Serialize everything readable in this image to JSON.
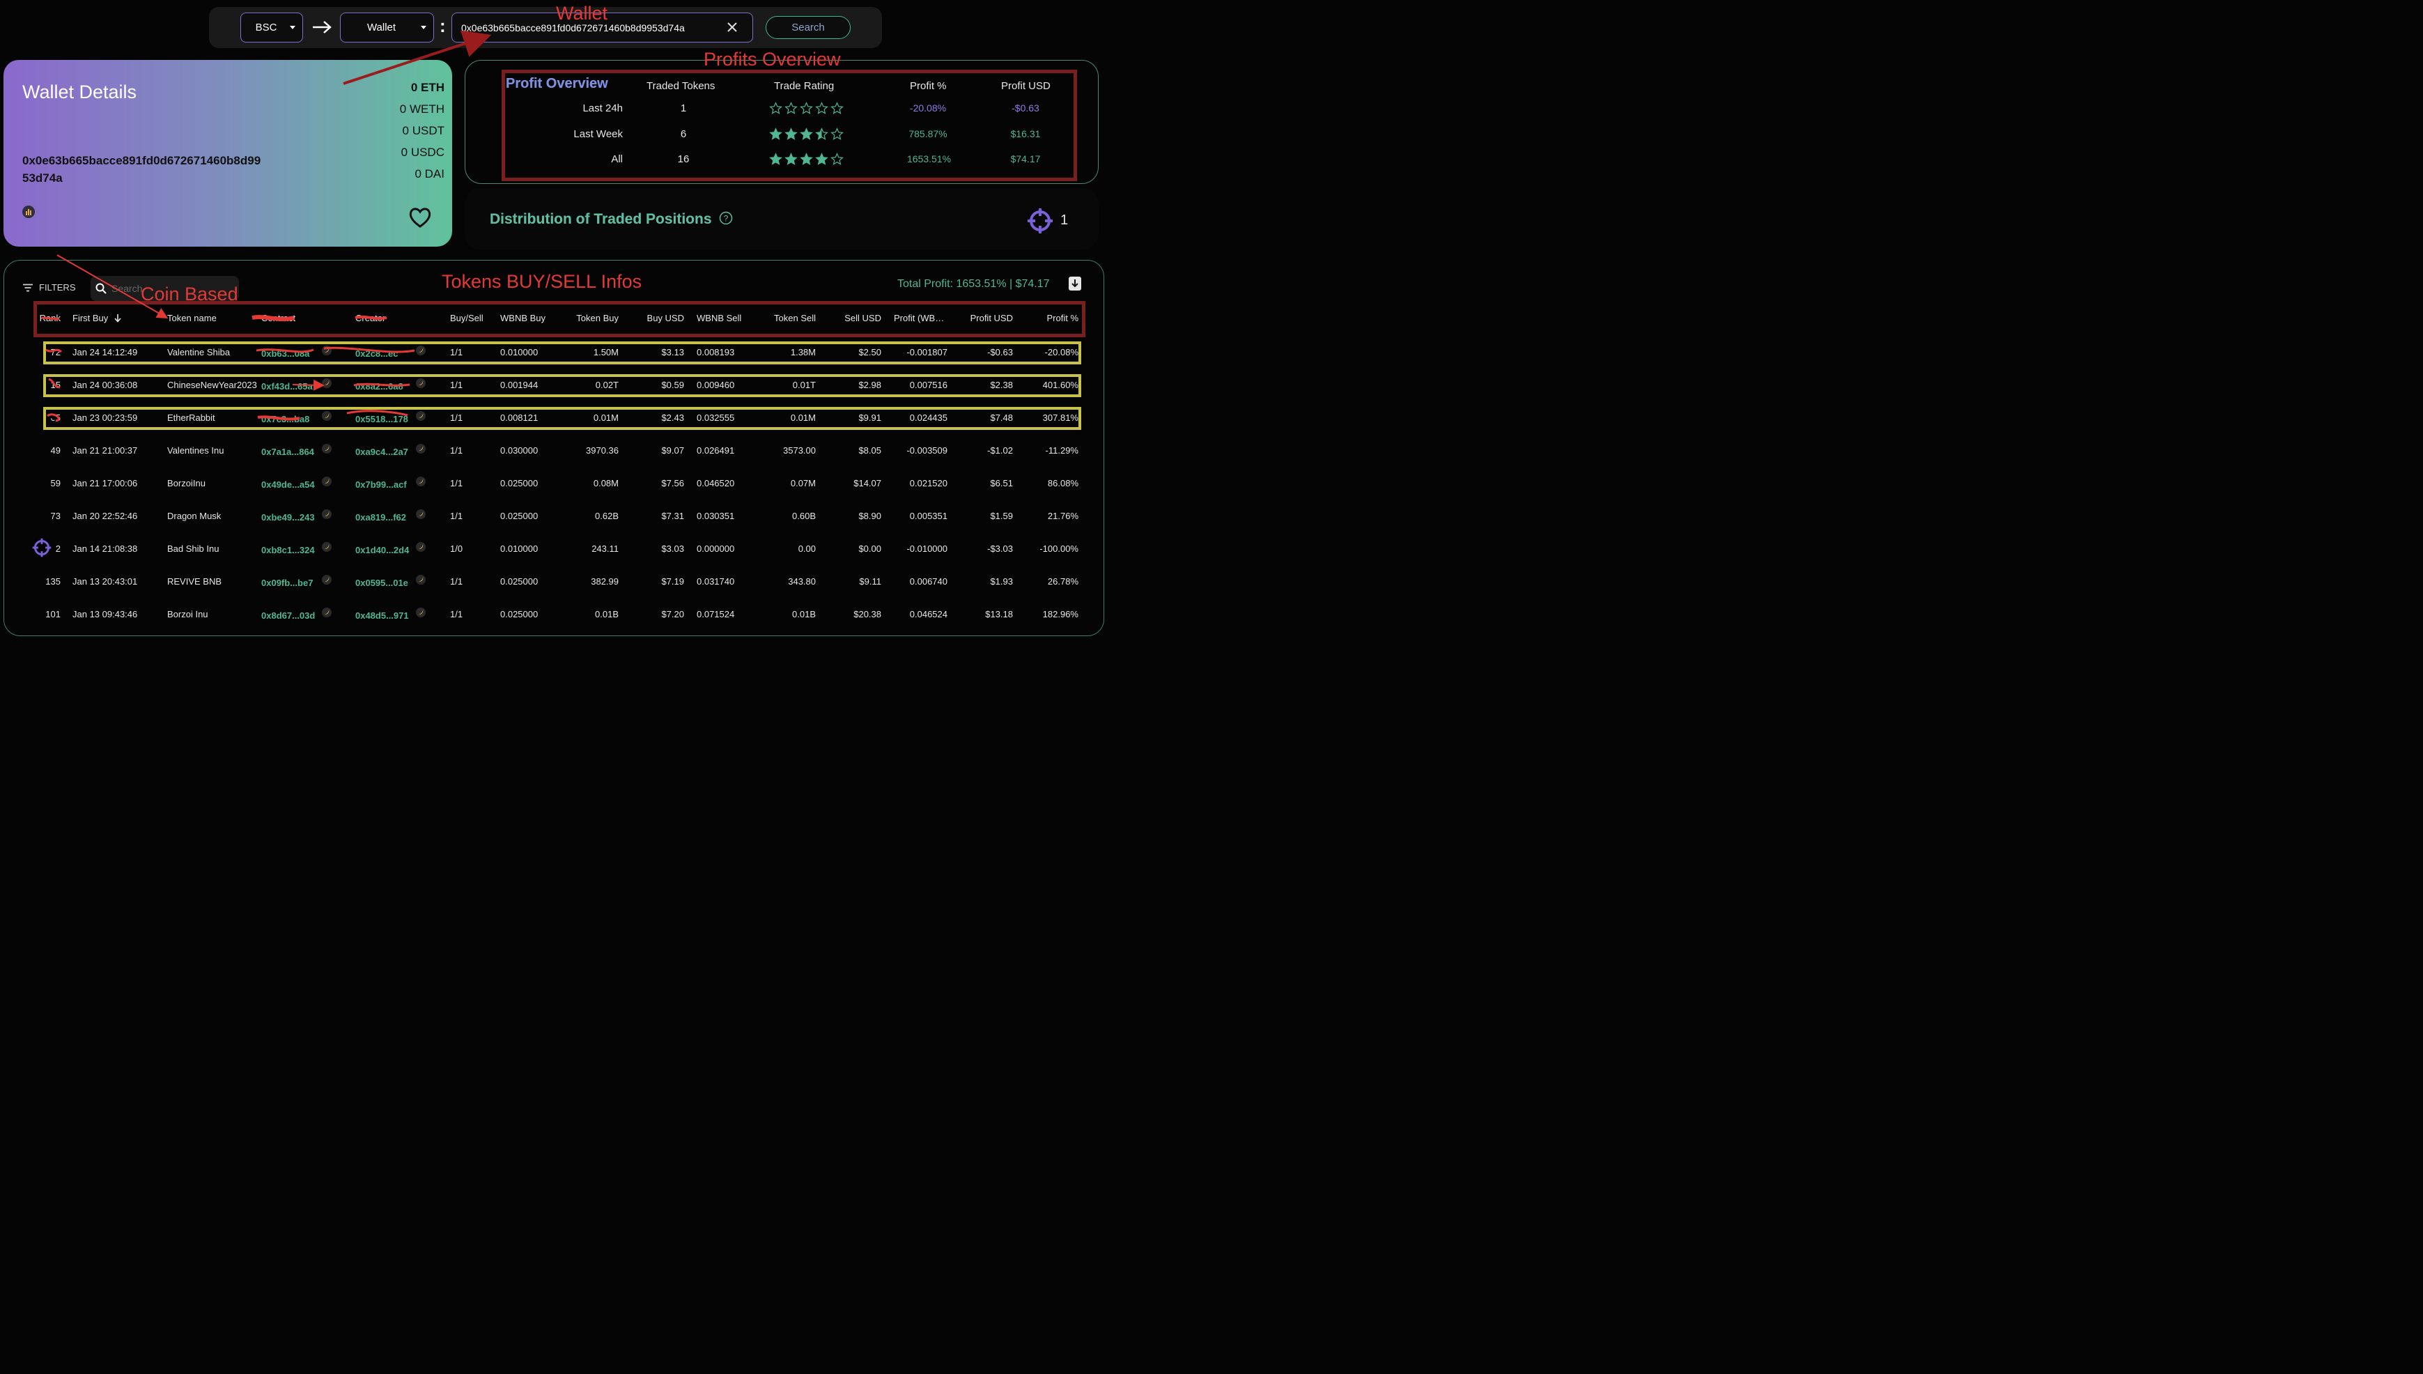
{
  "search_bar": {
    "chain": "BSC",
    "type": "Wallet",
    "address_value": "0x0e63b665bacce891fd0d672671460b8d9953d74a",
    "search_label": "Search"
  },
  "annotations": {
    "wallet": "Wallet",
    "profits_overview": "Profits Overview",
    "coin_based": "Coin Based",
    "tokens_info": "Tokens BUY/SELL Infos"
  },
  "wallet_card": {
    "title": "Wallet Details",
    "address_line1": "0x0e63b665bacce891fd0d672671460b8d99",
    "address_line2": "53d74a",
    "balances": [
      "0 ETH",
      "0 WETH",
      "0 USDT",
      "0 USDC",
      "0 DAI"
    ]
  },
  "profit_overview": {
    "title": "Profit Overview",
    "headers": [
      "Traded Tokens",
      "Trade Rating",
      "Profit %",
      "Profit USD"
    ],
    "rows": [
      {
        "label": "Last 24h",
        "traded": "1",
        "rating": 0,
        "pct": "-20.08%",
        "usd": "-$0.63",
        "negative": true
      },
      {
        "label": "Last Week",
        "traded": "6",
        "rating": 3.5,
        "pct": "785.87%",
        "usd": "$16.31",
        "negative": false
      },
      {
        "label": "All",
        "traded": "16",
        "rating": 4,
        "pct": "1653.51%",
        "usd": "$74.17",
        "negative": false
      }
    ]
  },
  "distribution": {
    "title": "Distribution of Traded Positions",
    "count": "1"
  },
  "table": {
    "filters_label": "FILTERS",
    "search_placeholder": "Search",
    "total_profit": "Total Profit: 1653.51% | $74.17",
    "headers": [
      "Rank",
      "First Buy",
      "Token name",
      "Contract",
      "Creator",
      "Buy/Sell",
      "WBNB Buy",
      "Token Buy",
      "Buy USD",
      "WBNB Sell",
      "Token Sell",
      "Sell USD",
      "Profit (WB…",
      "Profit USD",
      "Profit %"
    ],
    "rows": [
      {
        "rank": "72",
        "first_buy": "Jan 24 14:12:49",
        "token": "Valentine Shiba",
        "contract": "0xb63...08a",
        "creator": "0x2c8...ec",
        "bs": "1/1",
        "wbnb_buy": "0.010000",
        "token_buy": "1.50M",
        "buy_usd": "$3.13",
        "wbnb_sell": "0.008193",
        "token_sell": "1.38M",
        "sell_usd": "$2.50",
        "profit_wbnb": "-0.001807",
        "profit_usd": "-$0.63",
        "profit_pct": "-20.08%"
      },
      {
        "rank": "15",
        "first_buy": "Jan 24 00:36:08",
        "token": "ChineseNewYear2023",
        "contract": "0xf43d...65a",
        "creator": "0x8a2...6a8",
        "bs": "1/1",
        "wbnb_buy": "0.001944",
        "token_buy": "0.02T",
        "buy_usd": "$0.59",
        "wbnb_sell": "0.009460",
        "token_sell": "0.01T",
        "sell_usd": "$2.98",
        "profit_wbnb": "0.007516",
        "profit_usd": "$2.38",
        "profit_pct": "401.60%"
      },
      {
        "rank": "65",
        "first_buy": "Jan 23 00:23:59",
        "token": "EtherRabbit",
        "contract": "0x7c3...ba8",
        "creator": "0x5518...178",
        "bs": "1/1",
        "wbnb_buy": "0.008121",
        "token_buy": "0.01M",
        "buy_usd": "$2.43",
        "wbnb_sell": "0.032555",
        "token_sell": "0.01M",
        "sell_usd": "$9.91",
        "profit_wbnb": "0.024435",
        "profit_usd": "$7.48",
        "profit_pct": "307.81%"
      },
      {
        "rank": "49",
        "first_buy": "Jan 21 21:00:37",
        "token": "Valentines Inu",
        "contract": "0x7a1a...864",
        "creator": "0xa9c4...2a7",
        "bs": "1/1",
        "wbnb_buy": "0.030000",
        "token_buy": "3970.36",
        "buy_usd": "$9.07",
        "wbnb_sell": "0.026491",
        "token_sell": "3573.00",
        "sell_usd": "$8.05",
        "profit_wbnb": "-0.003509",
        "profit_usd": "-$1.02",
        "profit_pct": "-11.29%"
      },
      {
        "rank": "59",
        "first_buy": "Jan 21 17:00:06",
        "token": "BorzoiInu",
        "contract": "0x49de...a54",
        "creator": "0x7b99...acf",
        "bs": "1/1",
        "wbnb_buy": "0.025000",
        "token_buy": "0.08M",
        "buy_usd": "$7.56",
        "wbnb_sell": "0.046520",
        "token_sell": "0.07M",
        "sell_usd": "$14.07",
        "profit_wbnb": "0.021520",
        "profit_usd": "$6.51",
        "profit_pct": "86.08%"
      },
      {
        "rank": "73",
        "first_buy": "Jan 20 22:52:46",
        "token": "Dragon Musk",
        "contract": "0xbe49...243",
        "creator": "0xa819...f62",
        "bs": "1/1",
        "wbnb_buy": "0.025000",
        "token_buy": "0.62B",
        "buy_usd": "$7.31",
        "wbnb_sell": "0.030351",
        "token_sell": "0.60B",
        "sell_usd": "$8.90",
        "profit_wbnb": "0.005351",
        "profit_usd": "$1.59",
        "profit_pct": "21.76%"
      },
      {
        "rank": "2",
        "first_buy": "Jan 14 21:08:38",
        "token": "Bad Shib Inu",
        "contract": "0xb8c1...324",
        "creator": "0x1d40...2d4",
        "bs": "1/0",
        "wbnb_buy": "0.010000",
        "token_buy": "243.11",
        "buy_usd": "$3.03",
        "wbnb_sell": "0.000000",
        "token_sell": "0.00",
        "sell_usd": "$0.00",
        "profit_wbnb": "-0.010000",
        "profit_usd": "-$3.03",
        "profit_pct": "-100.00%"
      },
      {
        "rank": "135",
        "first_buy": "Jan 13 20:43:01",
        "token": "REVIVE BNB",
        "contract": "0x09fb...be7",
        "creator": "0x0595...01e",
        "bs": "1/1",
        "wbnb_buy": "0.025000",
        "token_buy": "382.99",
        "buy_usd": "$7.19",
        "wbnb_sell": "0.031740",
        "token_sell": "343.80",
        "sell_usd": "$9.11",
        "profit_wbnb": "0.006740",
        "profit_usd": "$1.93",
        "profit_pct": "26.78%"
      },
      {
        "rank": "101",
        "first_buy": "Jan 13 09:43:46",
        "token": "Borzoi Inu",
        "contract": "0x8d67...03d",
        "creator": "0x48d5...971",
        "bs": "1/1",
        "wbnb_buy": "0.025000",
        "token_buy": "0.01B",
        "buy_usd": "$7.20",
        "wbnb_sell": "0.071524",
        "token_sell": "0.01B",
        "sell_usd": "$20.38",
        "profit_wbnb": "0.046524",
        "profit_usd": "$13.18",
        "profit_pct": "182.96%"
      }
    ]
  }
}
